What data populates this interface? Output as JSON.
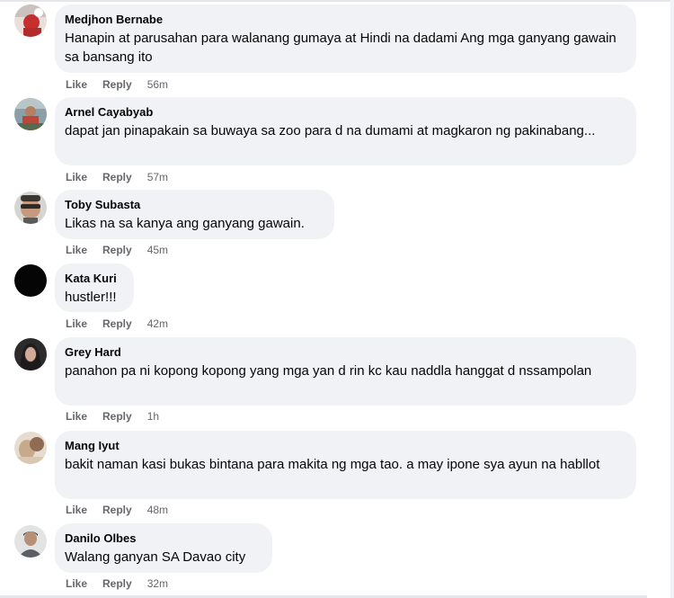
{
  "actions": {
    "like": "Like",
    "reply": "Reply"
  },
  "comments": [
    {
      "name": "Medjhon Bernabe",
      "text": "Hanapin at parusahan para walanang gumaya at Hindi na dadami Ang mga ganyang gawain sa bansang ito",
      "time": "56m",
      "avatar": "avatar-red-white"
    },
    {
      "name": "Arnel Cayabyab",
      "text": "dapat jan pinapakain sa buwaya sa zoo para d na dumami at magkaron ng pakinabang...",
      "time": "57m",
      "avatar": "avatar-outdoor"
    },
    {
      "name": "Toby Subasta",
      "text": "Likas na sa kanya ang ganyang gawain.",
      "time": "45m",
      "avatar": "avatar-man-sunglasses"
    },
    {
      "name": "Kata Kuri",
      "text": "hustler!!!",
      "time": "42m",
      "avatar": "avatar-black"
    },
    {
      "name": "Grey Hard",
      "text": "panahon pa ni kopong kopong yang mga yan d rin kc kau naddla hanggat d nssampolan",
      "time": "1h",
      "avatar": "avatar-dark-portrait"
    },
    {
      "name": "Mang Iyut",
      "text": "bakit naman kasi bukas bintana para makita ng mga tao. a may ipone sya ayun na habllot",
      "time": "48m",
      "avatar": "avatar-beige"
    },
    {
      "name": "Danilo Olbes",
      "text": "Walang ganyan SA Davao city",
      "time": "32m",
      "avatar": "avatar-person-gray"
    }
  ]
}
